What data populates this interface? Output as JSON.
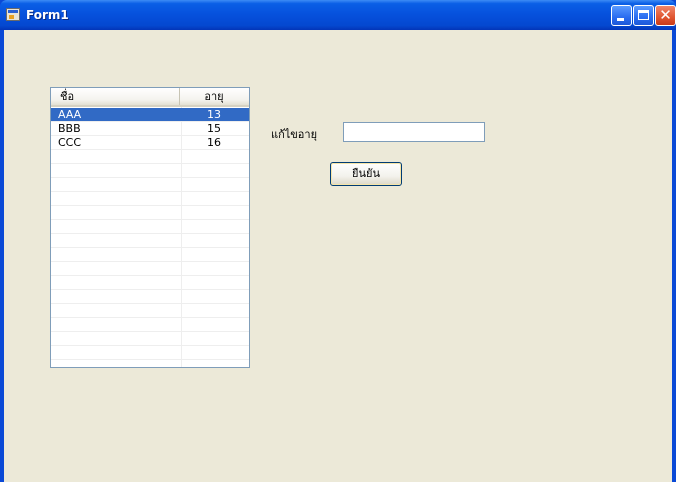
{
  "window": {
    "title": "Form1",
    "icon": "form-app-icon",
    "controls": {
      "minimize": "minimize-icon",
      "maximize": "maximize-icon",
      "close": "close-icon",
      "close_glyph": "✕"
    }
  },
  "listview": {
    "columns": [
      "ชื่อ",
      "อายุ"
    ],
    "rows": [
      {
        "name": "AAA",
        "age": "13",
        "selected": true
      },
      {
        "name": "BBB",
        "age": "15",
        "selected": false
      },
      {
        "name": "CCC",
        "age": "16",
        "selected": false
      }
    ]
  },
  "form": {
    "edit_label": "แก้ไขอายุ",
    "edit_value": "",
    "confirm_label": "ยืนยัน"
  },
  "colors": {
    "titlebar": "#0650dc",
    "selection": "#316ac5",
    "client_bg": "#ece9d8"
  }
}
